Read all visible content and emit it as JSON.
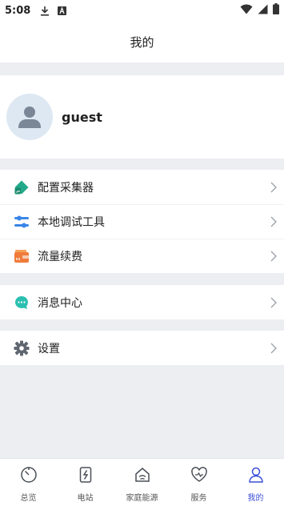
{
  "status_bar": {
    "time": "5:08",
    "icons": [
      "download-icon",
      "a-badge-icon",
      "wifi-icon",
      "signal-icon",
      "battery-icon"
    ]
  },
  "header": {
    "title": "我的"
  },
  "profile": {
    "username": "guest"
  },
  "menu": {
    "group1": [
      {
        "label": "配置采集器",
        "icon": "collector-config-icon",
        "color": "#22a98a"
      },
      {
        "label": "本地调试工具",
        "icon": "debug-tool-icon",
        "color": "#3a86e8"
      },
      {
        "label": "流量续费",
        "icon": "wallet-icon",
        "color": "#f07b3a"
      }
    ],
    "group2": [
      {
        "label": "消息中心",
        "icon": "message-icon",
        "color": "#2bbfb0"
      }
    ],
    "group3": [
      {
        "label": "设置",
        "icon": "gear-icon",
        "color": "#5f6670"
      }
    ]
  },
  "tabbar": {
    "active": "我的",
    "active_color": "#3b4fd6",
    "items": [
      {
        "label": "总览",
        "icon": "overview-icon"
      },
      {
        "label": "电站",
        "icon": "power-station-icon"
      },
      {
        "label": "家庭能源",
        "icon": "home-energy-icon"
      },
      {
        "label": "服务",
        "icon": "service-heart-icon"
      },
      {
        "label": "我的",
        "icon": "person-icon"
      }
    ]
  }
}
